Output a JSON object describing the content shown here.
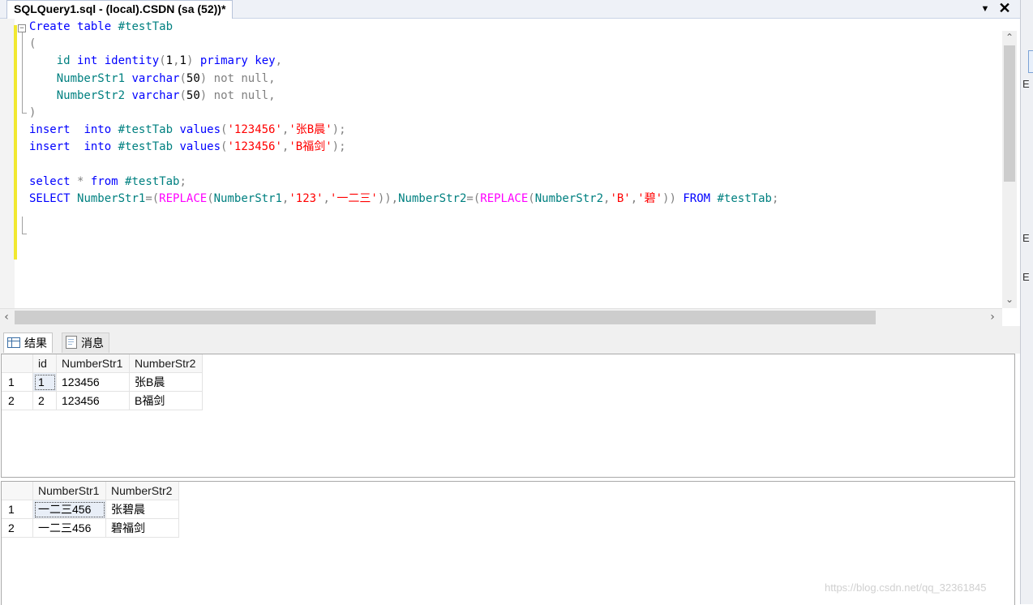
{
  "window": {
    "tab_title": "SQLQuery1.sql - (local).CSDN (sa (52))*",
    "dropdown_icon": "chevron-down-icon",
    "close_glyph": "✕"
  },
  "right_panel": {
    "marks": [
      "E",
      "E",
      "E"
    ]
  },
  "editor": {
    "lines": [
      [
        {
          "t": "Create",
          "c": "kw"
        },
        {
          "t": " "
        },
        {
          "t": "table",
          "c": "kw"
        },
        {
          "t": " "
        },
        {
          "t": "#testTab",
          "c": "ident"
        }
      ],
      [
        {
          "t": "(",
          "c": "gray"
        }
      ],
      [
        {
          "t": "    "
        },
        {
          "t": "id",
          "c": "ident"
        },
        {
          "t": " "
        },
        {
          "t": "int",
          "c": "kw"
        },
        {
          "t": " "
        },
        {
          "t": "identity",
          "c": "kw"
        },
        {
          "t": "(",
          "c": "gray"
        },
        {
          "t": "1",
          "c": "black"
        },
        {
          "t": ",",
          "c": "gray"
        },
        {
          "t": "1",
          "c": "black"
        },
        {
          "t": ")",
          "c": "gray"
        },
        {
          "t": " "
        },
        {
          "t": "primary",
          "c": "kw"
        },
        {
          "t": " "
        },
        {
          "t": "key",
          "c": "kw"
        },
        {
          "t": ",",
          "c": "gray"
        }
      ],
      [
        {
          "t": "    "
        },
        {
          "t": "NumberStr1",
          "c": "ident"
        },
        {
          "t": " "
        },
        {
          "t": "varchar",
          "c": "kw"
        },
        {
          "t": "(",
          "c": "gray"
        },
        {
          "t": "50",
          "c": "black"
        },
        {
          "t": ")",
          "c": "gray"
        },
        {
          "t": " "
        },
        {
          "t": "not",
          "c": "gray"
        },
        {
          "t": " "
        },
        {
          "t": "null",
          "c": "gray"
        },
        {
          "t": ",",
          "c": "gray"
        }
      ],
      [
        {
          "t": "    "
        },
        {
          "t": "NumberStr2",
          "c": "ident"
        },
        {
          "t": " "
        },
        {
          "t": "varchar",
          "c": "kw"
        },
        {
          "t": "(",
          "c": "gray"
        },
        {
          "t": "50",
          "c": "black"
        },
        {
          "t": ")",
          "c": "gray"
        },
        {
          "t": " "
        },
        {
          "t": "not",
          "c": "gray"
        },
        {
          "t": " "
        },
        {
          "t": "null",
          "c": "gray"
        },
        {
          "t": ",",
          "c": "gray"
        }
      ],
      [
        {
          "t": ")",
          "c": "gray"
        }
      ],
      [
        {
          "t": "insert",
          "c": "kw"
        },
        {
          "t": "  "
        },
        {
          "t": "into",
          "c": "kw"
        },
        {
          "t": " "
        },
        {
          "t": "#testTab",
          "c": "ident"
        },
        {
          "t": " "
        },
        {
          "t": "values",
          "c": "kw"
        },
        {
          "t": "(",
          "c": "gray"
        },
        {
          "t": "'123456'",
          "c": "str"
        },
        {
          "t": ",",
          "c": "gray"
        },
        {
          "t": "'张B晨'",
          "c": "str"
        },
        {
          "t": ");",
          "c": "gray"
        }
      ],
      [
        {
          "t": "insert",
          "c": "kw"
        },
        {
          "t": "  "
        },
        {
          "t": "into",
          "c": "kw"
        },
        {
          "t": " "
        },
        {
          "t": "#testTab",
          "c": "ident"
        },
        {
          "t": " "
        },
        {
          "t": "values",
          "c": "kw"
        },
        {
          "t": "(",
          "c": "gray"
        },
        {
          "t": "'123456'",
          "c": "str"
        },
        {
          "t": ",",
          "c": "gray"
        },
        {
          "t": "'B福剑'",
          "c": "str"
        },
        {
          "t": ");",
          "c": "gray"
        }
      ],
      [],
      [
        {
          "t": "select",
          "c": "kw"
        },
        {
          "t": " "
        },
        {
          "t": "*",
          "c": "gray"
        },
        {
          "t": " "
        },
        {
          "t": "from",
          "c": "kw"
        },
        {
          "t": " "
        },
        {
          "t": "#testTab",
          "c": "ident"
        },
        {
          "t": ";",
          "c": "gray"
        }
      ],
      [
        {
          "t": "SELECT",
          "c": "kw"
        },
        {
          "t": " "
        },
        {
          "t": "NumberStr1",
          "c": "ident"
        },
        {
          "t": "=(",
          "c": "gray"
        },
        {
          "t": "REPLACE",
          "c": "fn"
        },
        {
          "t": "(",
          "c": "gray"
        },
        {
          "t": "NumberStr1",
          "c": "ident"
        },
        {
          "t": ",",
          "c": "gray"
        },
        {
          "t": "'123'",
          "c": "str"
        },
        {
          "t": ",",
          "c": "gray"
        },
        {
          "t": "'一二三'",
          "c": "str"
        },
        {
          "t": ")),",
          "c": "gray"
        },
        {
          "t": "NumberStr2",
          "c": "ident"
        },
        {
          "t": "=(",
          "c": "gray"
        },
        {
          "t": "REPLACE",
          "c": "fn"
        },
        {
          "t": "(",
          "c": "gray"
        },
        {
          "t": "NumberStr2",
          "c": "ident"
        },
        {
          "t": ",",
          "c": "gray"
        },
        {
          "t": "'B'",
          "c": "str"
        },
        {
          "t": ",",
          "c": "gray"
        },
        {
          "t": "'碧'",
          "c": "str"
        },
        {
          "t": "))",
          "c": "gray"
        },
        {
          "t": " "
        },
        {
          "t": "FROM",
          "c": "kw"
        },
        {
          "t": " "
        },
        {
          "t": "#testTab",
          "c": "ident"
        },
        {
          "t": ";",
          "c": "gray"
        }
      ]
    ]
  },
  "result_tabs": [
    {
      "label": "结果",
      "icon": "grid-icon",
      "active": true
    },
    {
      "label": "消息",
      "icon": "message-icon",
      "active": false
    }
  ],
  "grid1": {
    "columns": [
      "",
      "id",
      "NumberStr1",
      "NumberStr2"
    ],
    "rows": [
      [
        "1",
        "1",
        "123456",
        "张B晨"
      ],
      [
        "2",
        "2",
        "123456",
        "B福剑"
      ]
    ]
  },
  "grid2": {
    "columns": [
      "",
      "NumberStr1",
      "NumberStr2"
    ],
    "rows": [
      [
        "1",
        "一二三456",
        "张碧晨"
      ],
      [
        "2",
        "一二三456",
        "碧福剑"
      ]
    ]
  },
  "watermark": "https://blog.csdn.net/qq_32361845"
}
